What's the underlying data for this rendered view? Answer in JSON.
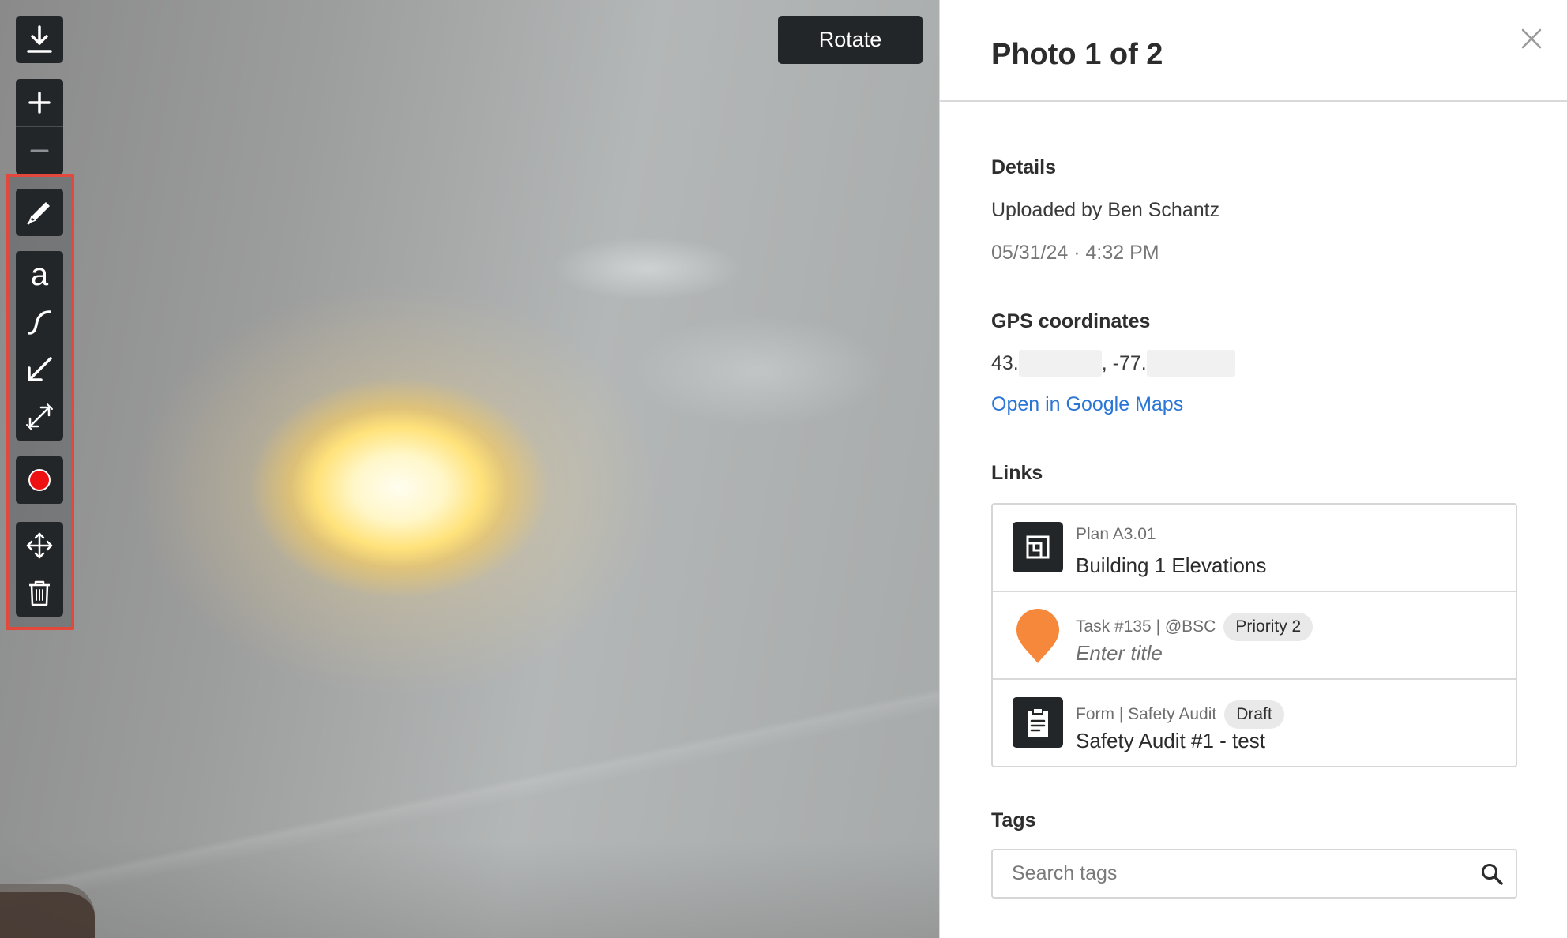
{
  "viewer": {
    "rotate_label": "Rotate",
    "tools": {
      "download": "download-icon",
      "zoom_in": "plus-icon",
      "zoom_out": "minus-icon",
      "pencil": "pencil-icon",
      "text": "a",
      "freehand": "curve-icon",
      "arrow": "arrow-icon",
      "measure": "double-arrow-icon",
      "color": "#ee1111",
      "move": "move-icon",
      "delete": "trash-icon"
    },
    "highlight_color": "#e2483c"
  },
  "panel": {
    "title": "Photo 1 of 2",
    "details": {
      "heading": "Details",
      "uploaded_by": "Uploaded by Ben Schantz",
      "timestamp": "05/31/24 · 4:32 PM"
    },
    "gps": {
      "heading": "GPS coordinates",
      "lat_prefix": "43.",
      "lon_prefix": ", -77.",
      "maps_link": "Open in Google Maps"
    },
    "links": {
      "heading": "Links",
      "items": [
        {
          "icon": "plan-icon",
          "meta": "Plan A3.01",
          "title": "Building 1 Elevations",
          "badge": ""
        },
        {
          "icon": "location-pin-icon",
          "meta": "Task #135 | @BSC",
          "title": "Enter title",
          "badge": "Priority 2"
        },
        {
          "icon": "clipboard-icon",
          "meta": "Form | Safety Audit",
          "title": "Safety Audit #1 - test",
          "badge": "Draft"
        }
      ]
    },
    "tags": {
      "heading": "Tags",
      "placeholder": "Search tags"
    }
  },
  "colors": {
    "accent_link": "#2a75d6",
    "toolbar_bg": "#232629",
    "task_pin": "#f5883a"
  }
}
